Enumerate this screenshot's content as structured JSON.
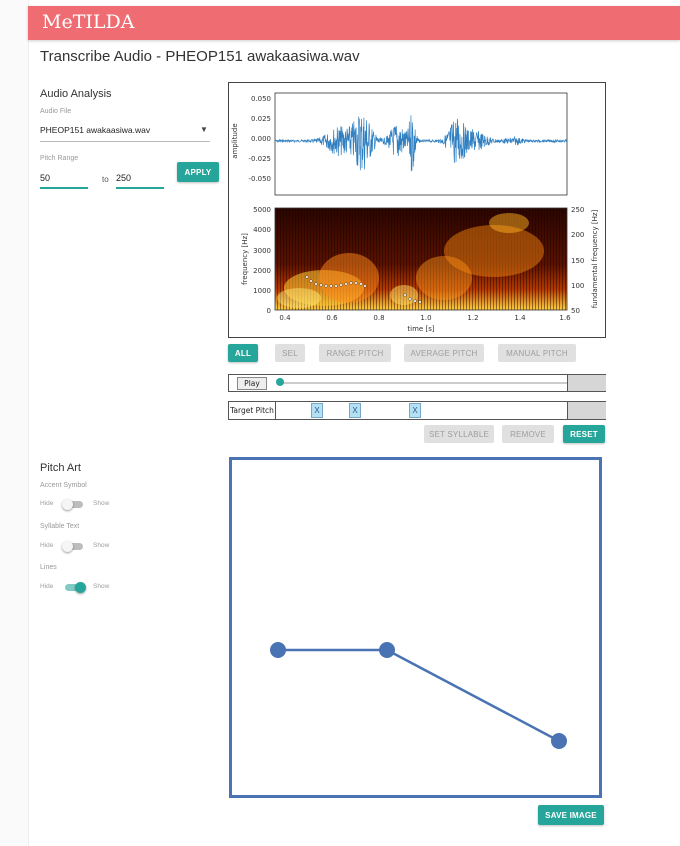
{
  "app": {
    "title": "MeTILDA"
  },
  "page": {
    "title": "Transcribe Audio - PHEOP151 awakaasiwa.wav"
  },
  "audio_analysis": {
    "title": "Audio Analysis",
    "audio_file_label": "Audio File",
    "audio_file_value": "PHEOP151 awakaasiwa.wav",
    "pitch_range_label": "Pitch Range",
    "pitch_min": "50",
    "to_text": "to",
    "pitch_max": "250",
    "apply_label": "APPLY"
  },
  "waveform": {
    "ylabel": "amplitude",
    "y_ticks": [
      "0.050",
      "0.025",
      "0.000",
      "-0.025",
      "-0.050"
    ],
    "color": "#2f7fc1"
  },
  "spectrogram": {
    "ylabel_left": "frequency [Hz]",
    "ylabel_right": "fundamental frequency [Hz]",
    "xlabel": "time [s]",
    "y_ticks_left": [
      "5000",
      "4000",
      "3000",
      "2000",
      "1000",
      "0"
    ],
    "y_ticks_right": [
      "250",
      "200",
      "150",
      "100",
      "50"
    ],
    "x_ticks": [
      "0.4",
      "0.6",
      "0.8",
      "1.0",
      "1.2",
      "1.4",
      "1.6"
    ]
  },
  "selection_buttons": {
    "all": "ALL",
    "sel": "SEL",
    "range_pitch": "RANGE PITCH",
    "average_pitch": "AVERAGE PITCH",
    "manual_pitch": "MANUAL PITCH"
  },
  "player": {
    "play_label": "Play",
    "progress": 0.0
  },
  "target_pitch": {
    "label": "Target Pitch",
    "markers": [
      "X",
      "X",
      "X"
    ]
  },
  "syllable_buttons": {
    "set_syllable": "SET SYLLABLE",
    "remove": "REMOVE",
    "reset": "RESET"
  },
  "pitch_art": {
    "title": "Pitch Art",
    "toggles": [
      {
        "label": "Accent Symbol",
        "off": "Hide",
        "on": "Show",
        "checked": false
      },
      {
        "label": "Syllable Text",
        "off": "Hide",
        "on": "Show",
        "checked": false
      },
      {
        "label": "Lines",
        "off": "Hide",
        "on": "Show",
        "checked": true
      }
    ],
    "line_color": "#4a73b3",
    "save_label": "SAVE IMAGE"
  },
  "colors": {
    "accent": "#26a69a",
    "app_bar": "#ef6c72",
    "pitch_art_border": "#4a73b3"
  }
}
